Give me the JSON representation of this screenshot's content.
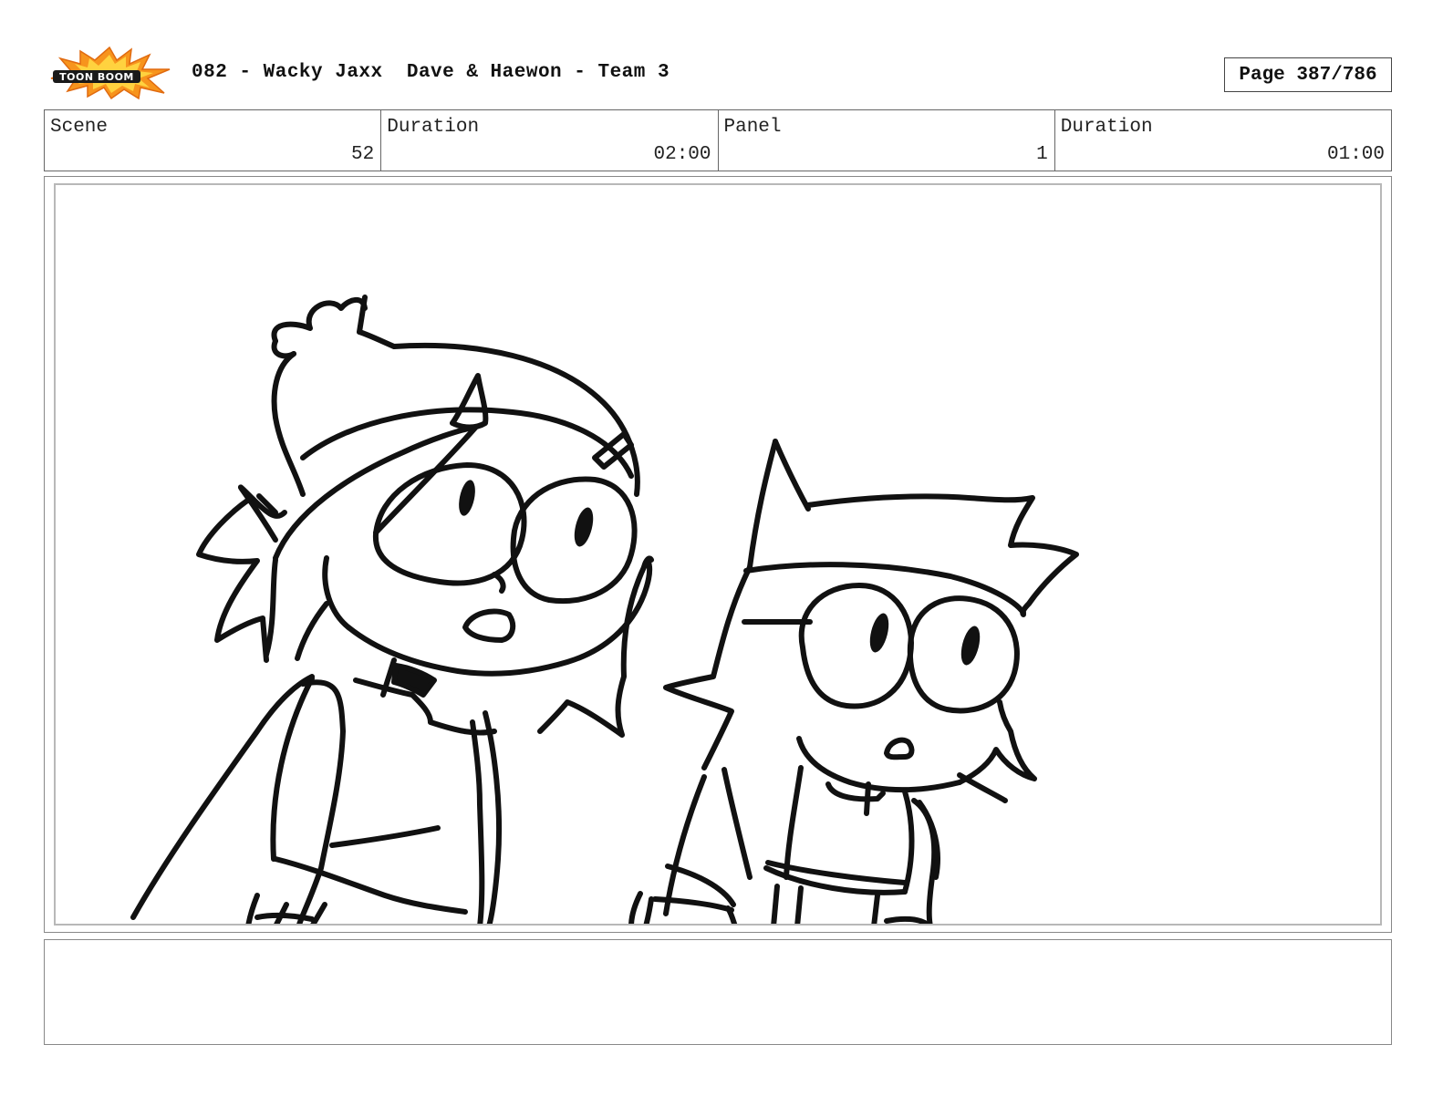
{
  "header": {
    "logo_text": "TOON BOOM",
    "title": "082 - Wacky Jaxx  Dave & Haewon - Team 3",
    "page": "Page 387/786"
  },
  "info": {
    "scene_label": "Scene",
    "scene_value": "52",
    "scene_duration_label": "Duration",
    "scene_duration_value": "02:00",
    "panel_label": "Panel",
    "panel_value": "1",
    "panel_duration_label": "Duration",
    "panel_duration_value": "01:00"
  },
  "panel": {
    "image": "storyboard-sketch-two-characters",
    "colors": {
      "logo_burst": "#f7941d",
      "logo_badge": "#1a1a1a",
      "ink": "#111111"
    }
  },
  "notes": {
    "text": ""
  }
}
